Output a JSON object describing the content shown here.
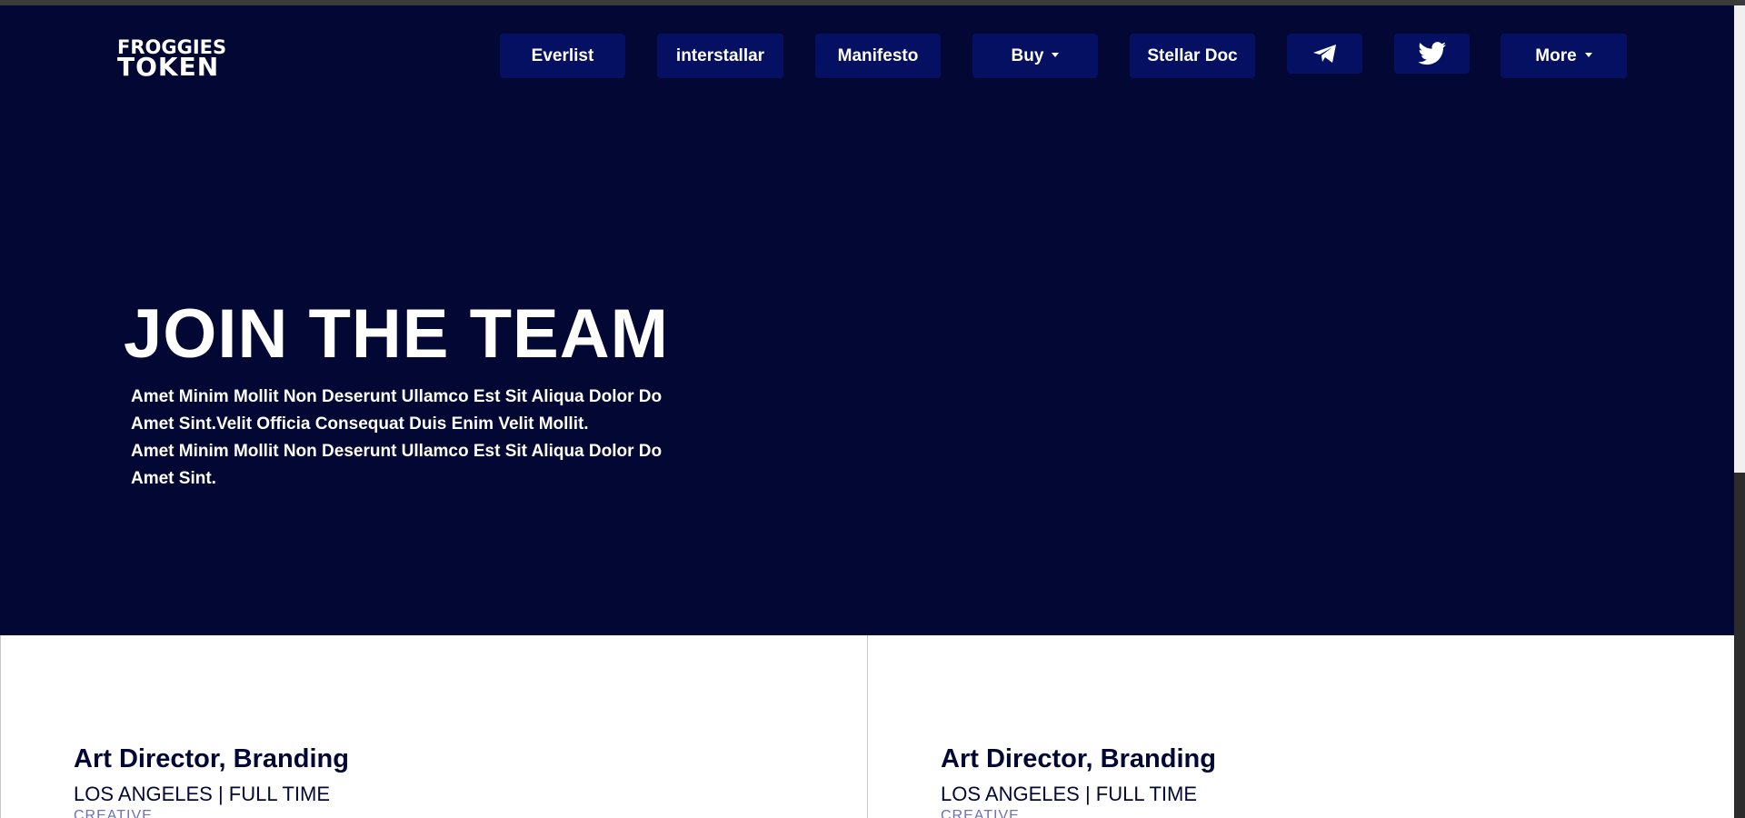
{
  "logo": {
    "line1": "FROGGIES",
    "line2": "TOKEN"
  },
  "nav": {
    "items": [
      {
        "label": "Everlist",
        "dropdown": false
      },
      {
        "label": "interstallar",
        "dropdown": false
      },
      {
        "label": "Manifesto",
        "dropdown": false
      },
      {
        "label": "Buy",
        "dropdown": true
      },
      {
        "label": "Stellar Doc",
        "dropdown": false
      }
    ],
    "telegram_icon": "telegram-icon",
    "twitter_icon": "twitter-icon",
    "more": {
      "label": "More",
      "dropdown": true
    }
  },
  "hero": {
    "title": "JOIN THE TEAM",
    "paragraph1": "Amet Minim Mollit Non Deserunt Ullamco Est Sit Aliqua Dolor Do Amet Sint.Velit Officia Consequat Duis Enim Velit Mollit.",
    "paragraph2": "Amet Minim Mollit Non Deserunt Ullamco Est Sit Aliqua Dolor Do Amet Sint."
  },
  "jobs": [
    {
      "title": "Art Director, Branding",
      "meta": "LOS ANGELES | FULL TIME",
      "category": "CREATIVE"
    },
    {
      "title": "Art Director, Branding",
      "meta": "LOS ANGELES | FULL TIME",
      "category": "CREATIVE"
    }
  ],
  "colors": {
    "hero_bg": "#020833",
    "nav_button_bg": "#051063",
    "text_light": "#ffffff",
    "text_dark": "#020833",
    "category_text": "#6a72b8"
  }
}
